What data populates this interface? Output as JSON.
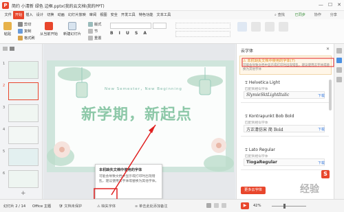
{
  "window": {
    "title": "简约 小清新 绿色 边框.pptx(我的云文档\\我的PPT)",
    "login_label": "已同步",
    "collab_label": "协作",
    "share_label": "分享"
  },
  "menu": {
    "items": [
      "文件",
      "开始",
      "插入",
      "设计",
      "切换",
      "动画",
      "幻灯片放映",
      "审阅",
      "视图",
      "安全",
      "开发工具",
      "特色功能",
      "文本工具"
    ],
    "active_index": 1,
    "search_label": "查找"
  },
  "ribbon": {
    "paste": "粘贴",
    "cut": "剪切",
    "copy": "复制",
    "format_painter": "格式刷",
    "from_current": "从当前开始",
    "new_slide": "新建幻灯片",
    "layout": "版式",
    "section": "节",
    "reset": "重置"
  },
  "thumbnails": {
    "numbers": [
      "1",
      "2",
      "3",
      "4",
      "5",
      "6"
    ],
    "add_symbol": "+"
  },
  "slide": {
    "subtitle": "New Semester，New Beginning",
    "title": "新学期，新起点"
  },
  "cloud_fonts": {
    "header": "云字体",
    "notice_title": "本机缺失文档中使用的字体",
    "notice_count": "(7)",
    "notice_desc": "可能会导致文档中显示或打印时出现错乱，建议使用云字体或替换为其他字体",
    "fonts": [
      {
        "name": "Helvetica Light",
        "sub": "匹配到相似字体",
        "preview": "SlymieSktLightItalic",
        "action": "下载"
      },
      {
        "name": "Kontrapunkt Bob Bold",
        "sub": "匹配到相似字体",
        "preview": "方正清仿宋 简 Bold",
        "action": "下载"
      },
      {
        "name": "Lato Regular",
        "sub": "匹配到相似字体",
        "preview": "TiogaRegular",
        "action": "下载"
      }
    ],
    "more_button": "更多云字体"
  },
  "popup": {
    "title": "本机缺失文档中使用的字体",
    "body": "可能会导致文档中显示或打印时出现错乱，建议使用云字体或替换为其他字体。"
  },
  "status": {
    "slide_info": "幻灯片 2 / 14",
    "theme": "Office 主题",
    "doc_protect": "文档未保护",
    "missing_font": "缺失字体",
    "notes_hint": "单击此处添加备注",
    "zoom": "42%"
  },
  "watermark": "经验"
}
